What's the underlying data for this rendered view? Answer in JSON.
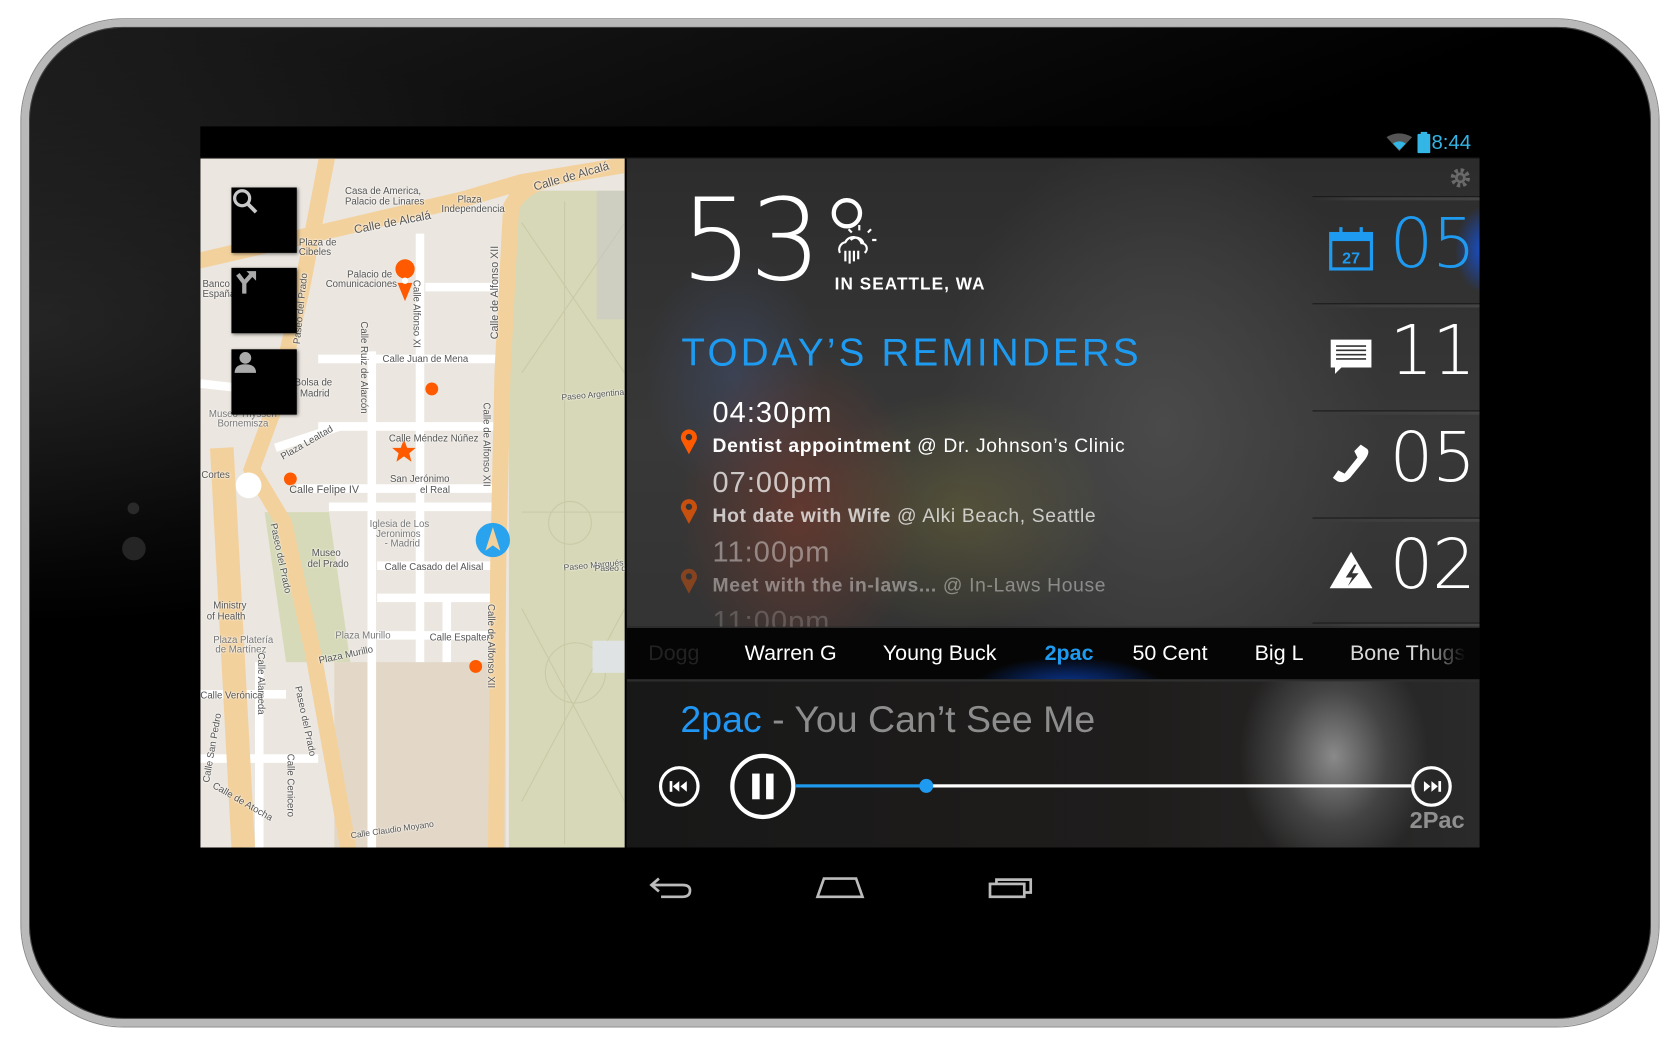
{
  "status_bar": {
    "time": "8:44",
    "icons": [
      "wifi-icon",
      "battery-icon"
    ]
  },
  "map": {
    "buttons": [
      {
        "icon": "search-icon"
      },
      {
        "icon": "directions-icon"
      },
      {
        "icon": "person-icon"
      }
    ],
    "labels": [
      "Calle de Alcalá",
      "Calle de Alcalá",
      "Casa de America,",
      "Palacio de Linares",
      "Plaza",
      "Independencia",
      "Plaza de",
      "Cibeles",
      "Banco de",
      "España",
      "Palacio de",
      "Comunicaciones",
      "Paseo del Prado",
      "Calle Alfonso XI",
      "Calle Ruiz de Alarcón",
      "Calle de Alfonso XII",
      "Calle Juan de Mena",
      "Bolsa de",
      "Madrid",
      "Museo Thyssen",
      "Bornemisza",
      "Plaza Lealtad",
      "Calle Méndez Núñez",
      "Cortes",
      "Calle Felipe IV",
      "San Jerónimo",
      "el Real",
      "Iglesia de Los",
      "Jeronimos",
      "- Madrid",
      "Museo",
      "del Prado",
      "Calle Casado del Alisal",
      "Paseo del Prado",
      "Ministry",
      "of Health",
      "Plaza Platería",
      "de Martínez",
      "Calle Espalter",
      "Plaza Murillo",
      "Plaza Murillo",
      "Calle Alameda",
      "Calle Verónica",
      "Calle San Pedro",
      "Calle de Atocha",
      "Calle Claudio Moyano",
      "Paseo Argentina",
      "Paseo Marqués",
      "Calle de Alfonso XII",
      "Calle de Alfonso XII",
      "Paseo del Prado",
      "Calle Cenicero",
      "Paseo de"
    ]
  },
  "weather": {
    "temperature": "53°",
    "location": "IN SEATTLE, WA",
    "icon": "partly-sunny-rain-icon"
  },
  "reminders": {
    "title": "TODAY’S REMINDERS",
    "items": [
      {
        "time": "04:30pm",
        "title": "Dentist appointment",
        "place": "@ Dr. Johnson’s Clinic"
      },
      {
        "time": "07:00pm",
        "title": "Hot date with Wife",
        "place": "@ Alki Beach, Seattle"
      },
      {
        "time": "11:00pm",
        "title": "Meet with the in-laws...",
        "place": "@ In-Laws House"
      },
      {
        "time": "11:00pm"
      }
    ]
  },
  "stats": [
    {
      "icon": "calendar-icon",
      "calendar_day": "27",
      "count": "05",
      "color": "#1e9bf0"
    },
    {
      "icon": "message-icon",
      "count": "11",
      "color": "#ffffff"
    },
    {
      "icon": "phone-icon",
      "count": "05",
      "color": "#ffffff"
    },
    {
      "icon": "alert-icon",
      "count": "02",
      "color": "#ffffff"
    }
  ],
  "artists": {
    "items": [
      "Dogg",
      "Warren G",
      "Young Buck",
      "2pac",
      "50 Cent",
      "Big L",
      "Bone Thugs"
    ],
    "selected": "2pac"
  },
  "player": {
    "artist": "2pac",
    "separator": "-",
    "song": "You Can’t See Me",
    "progress_percent": 21,
    "state": "playing",
    "album_text": "2Pac"
  },
  "colors": {
    "accent": "#1e9bf0",
    "marker": "#ff5a00"
  }
}
